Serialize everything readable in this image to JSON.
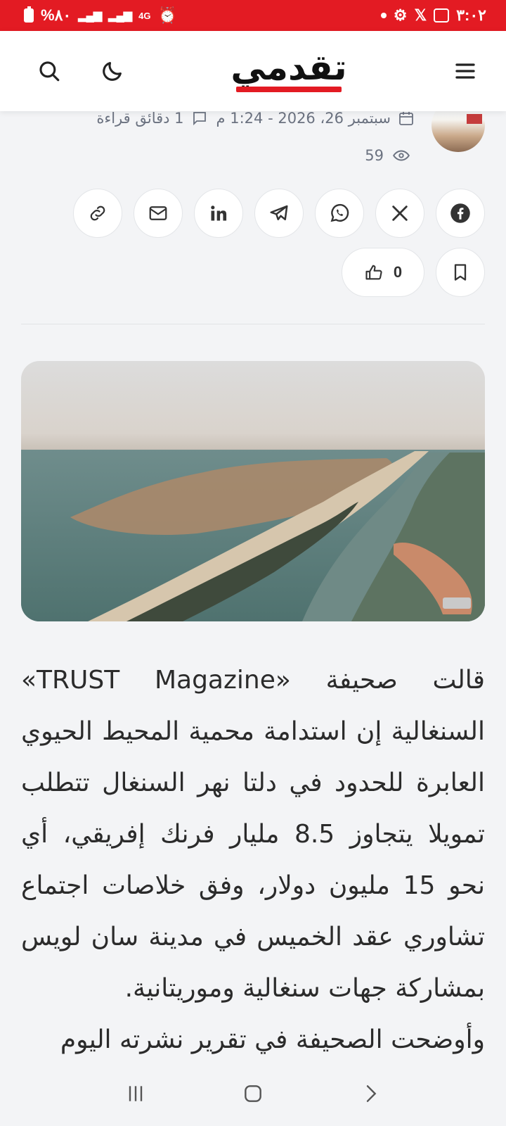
{
  "status_bar": {
    "time": "٣:٠٢",
    "battery": "%٨٠",
    "network": "4G"
  },
  "header": {
    "logo_text": "تقدمي",
    "brand_color": "#e31b23"
  },
  "meta": {
    "date": "سبتمبر 26، 2026 - 1:24 م",
    "read_time": "1 دقائق قراءة",
    "views": "59"
  },
  "share": {
    "buttons": [
      "facebook-icon",
      "x-icon",
      "whatsapp-icon",
      "telegram-icon",
      "linkedin-icon",
      "email-icon",
      "link-icon"
    ]
  },
  "actions": {
    "likes": "0"
  },
  "article": {
    "paragraph1": "قالت صحيفة «TRUST Magazine» السنغالية إن استدامة محمية المحيط الحيوي العابرة للحدود في دلتا نهر السنغال تتطلب تمويلا يتجاوز 8.5 مليار فرنك إفريقي، أي نحو 15 مليون دولار، وفق خلاصات اجتماع تشاوري عقد الخميس في مدينة سان لويس بمشاركة جهات سنغالية وموريتانية.",
    "paragraph2": "وأوضحت الصحيفة في تقرير نشرته اليوم"
  }
}
